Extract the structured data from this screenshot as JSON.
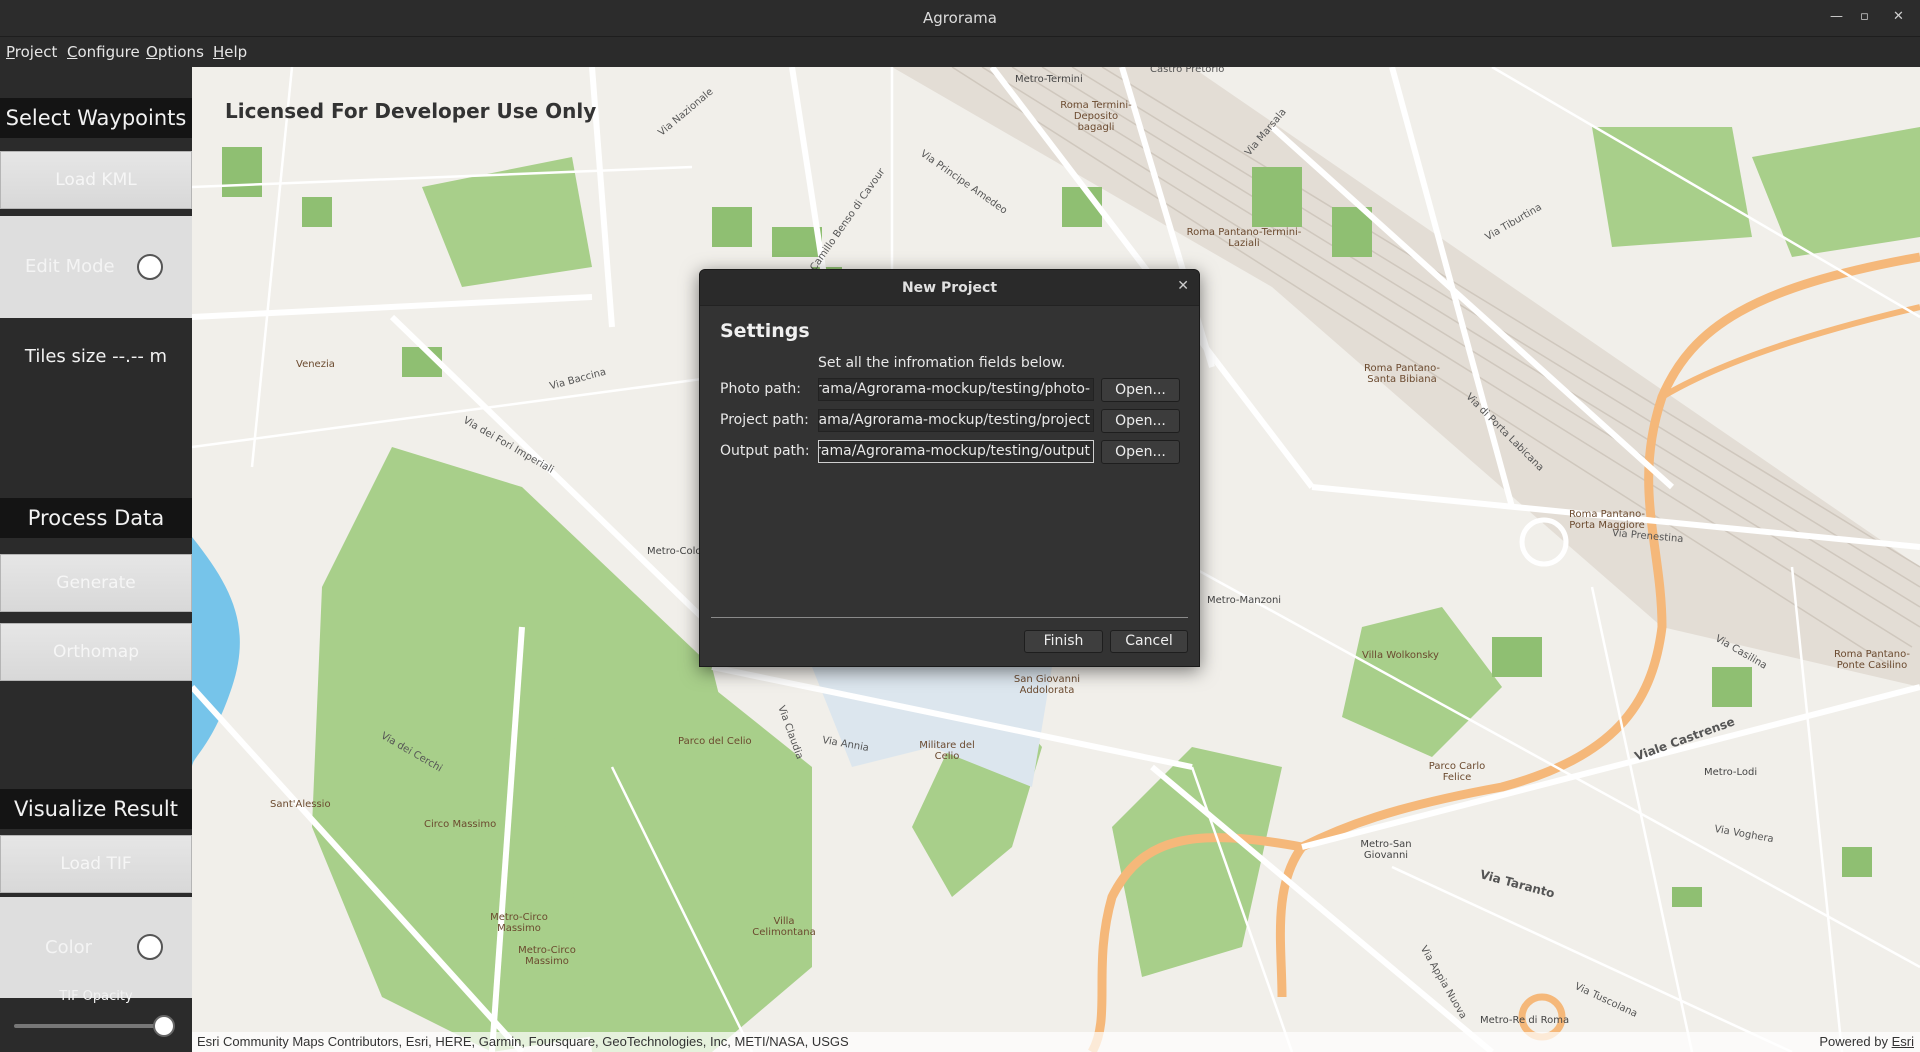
{
  "window": {
    "title": "Agrorama",
    "minimize_glyph": "—",
    "maximize_glyph": "▫",
    "close_glyph": "✕"
  },
  "menubar": {
    "items": [
      {
        "label": "Project"
      },
      {
        "label": "Configure"
      },
      {
        "label": "Options"
      },
      {
        "label": "Help"
      }
    ]
  },
  "sidebar": {
    "select_waypoints": {
      "heading": "Select Waypoints",
      "load_kml": "Load KML",
      "edit_mode": "Edit Mode",
      "tiles_size": "Tiles size --.-- m"
    },
    "process_data": {
      "heading": "Process Data",
      "generate": "Generate",
      "orthomap": "Orthomap"
    },
    "visualize_result": {
      "heading": "Visualize Result",
      "load_tif": "Load TIF",
      "color": "Color",
      "tif_opacity_label": "TIF Opacity",
      "tif_opacity_value": 1.0
    }
  },
  "map": {
    "watermark": "Licensed For Developer Use Only",
    "attribution": "Esri Community Maps Contributors, Esri, HERE, Garmin, Foursquare, GeoTechnologies, Inc, METI/NASA, USGS",
    "powered_by": "Powered by",
    "powered_by_link": "Esri",
    "labels": {
      "castro_pretorio": "Castro Pretorio",
      "metro_termini": "Metro-Termini",
      "roma_termini_deposito": "Roma Termini-Deposito bagagli",
      "roma_pantano_termini": "Roma Pantano-Termini-Laziali",
      "roma_pantano_santa_bibiana": "Roma Pantano-Santa Bibiana",
      "roma_pantano_porta_maggiore": "Roma Pantano-Porta Maggiore",
      "roma_pantano_ponte_casilino": "Roma Pantano-Ponte Casilino",
      "venezia": "Venezia",
      "metro_colosseo": "Metro-Colo",
      "metro_manzoni": "Metro-Manzoni",
      "villa_wolkonsky": "Villa Wolkonsky",
      "san_giovanni_addolorata": "San Giovanni Addolorata",
      "militare_del_celio": "Militare del Celio",
      "parco_del_celio": "Parco del Celio",
      "parco_carlo_felice": "Parco Carlo Felice",
      "metro_lodi": "Metro-Lodi",
      "metro_san_giovanni": "Metro-San Giovanni",
      "sant_alessio": "Sant'Alessio",
      "circo_massimo": "Circo Massimo",
      "metro_circo_massimo_1": "Metro-Circo Massimo",
      "metro_circo_massimo_2": "Metro-Circo Massimo",
      "villa_celimontana": "Villa Celimontana",
      "metro_re_di_roma": "Metro-Re di Roma",
      "via_tiburtina": "Via Tiburtina",
      "viale_castrense": "Viale Castrense",
      "via_taranto": "Via Taranto",
      "via_prenestina": "Via Prenestina",
      "via_casilina": "Via Casilina",
      "via_nazionale": "Via Nazionale",
      "via_baccina": "Via Baccina",
      "via_dei_fori_imperiali": "Via dei Fori Imperiali",
      "via_dei_cerchi": "Via dei Cerchi",
      "via_annia": "Via Annia",
      "via_claudia": "Via Claudia",
      "via_marsala": "Via Marsala",
      "via_cavour": "Via Camillo Benso di Cavour",
      "via_principe_amedeo": "Via Principe Amedeo",
      "via_appia_nuova": "Via Appia Nuova",
      "via_tuscolana": "Via Tuscolana",
      "via_voghera": "Via Voghera",
      "via_di_porta_labicana": "Via di Porta Labicana"
    }
  },
  "dialog": {
    "title": "New Project",
    "close_glyph": "✕",
    "heading": "Settings",
    "instructions": "Set all the infromation fields below.",
    "fields": [
      {
        "label": "Photo path:",
        "value": "-rama/Agrorama-mockup/testing/photo",
        "button": "Open..."
      },
      {
        "label": "Project path:",
        "value": "rama/Agrorama-mockup/testing/project",
        "button": "Open..."
      },
      {
        "label": "Output path:",
        "value": "rama/Agrorama-mockup/testing/output",
        "button": "Open..."
      }
    ],
    "finish": "Finish",
    "cancel": "Cancel"
  }
}
